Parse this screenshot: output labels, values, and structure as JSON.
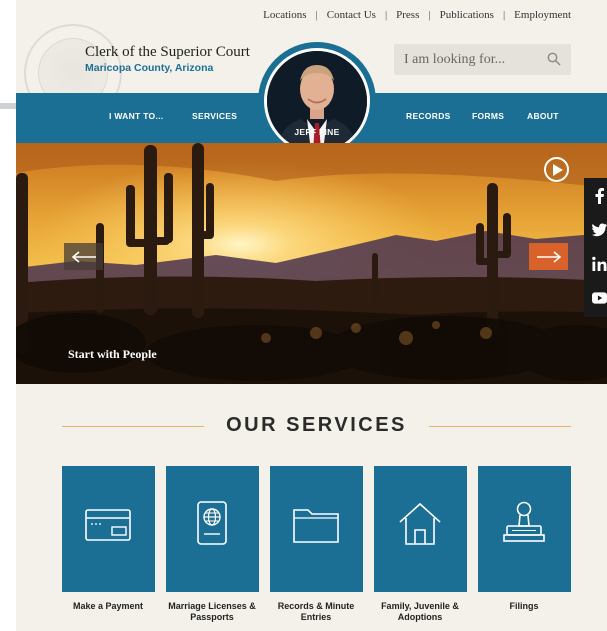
{
  "util_nav": [
    "Locations",
    "Contact Us",
    "Press",
    "Publications",
    "Employment"
  ],
  "site": {
    "title": "Clerk of the Superior Court",
    "subtitle": "Maricopa County, Arizona"
  },
  "search": {
    "placeholder": "I am looking for..."
  },
  "main_nav": {
    "i_want_to": "I WANT TO...",
    "services": "SERVICES",
    "records": "RECORDS",
    "forms": "FORMS",
    "about": "ABOUT"
  },
  "portrait": {
    "name": "JEFF FINE"
  },
  "hero": {
    "caption": "Start with People"
  },
  "social": [
    "facebook-icon",
    "twitter-icon",
    "linkedin-icon",
    "youtube-icon"
  ],
  "services": {
    "heading": "OUR SERVICES",
    "tiles": [
      {
        "label": "Make a Payment",
        "icon": "credit-card-icon"
      },
      {
        "label": "Marriage Licenses & Passports",
        "icon": "passport-icon"
      },
      {
        "label": "Records & Minute Entries",
        "icon": "folder-icon"
      },
      {
        "label": "Family, Juvenile & Adoptions",
        "icon": "house-icon"
      },
      {
        "label": "Filings",
        "icon": "stamp-icon"
      }
    ]
  },
  "colors": {
    "brand_blue": "#1b6e94",
    "accent_orange": "#d9622b",
    "page_bg": "#f3f1e9",
    "gold_line": "#e0b46a"
  }
}
